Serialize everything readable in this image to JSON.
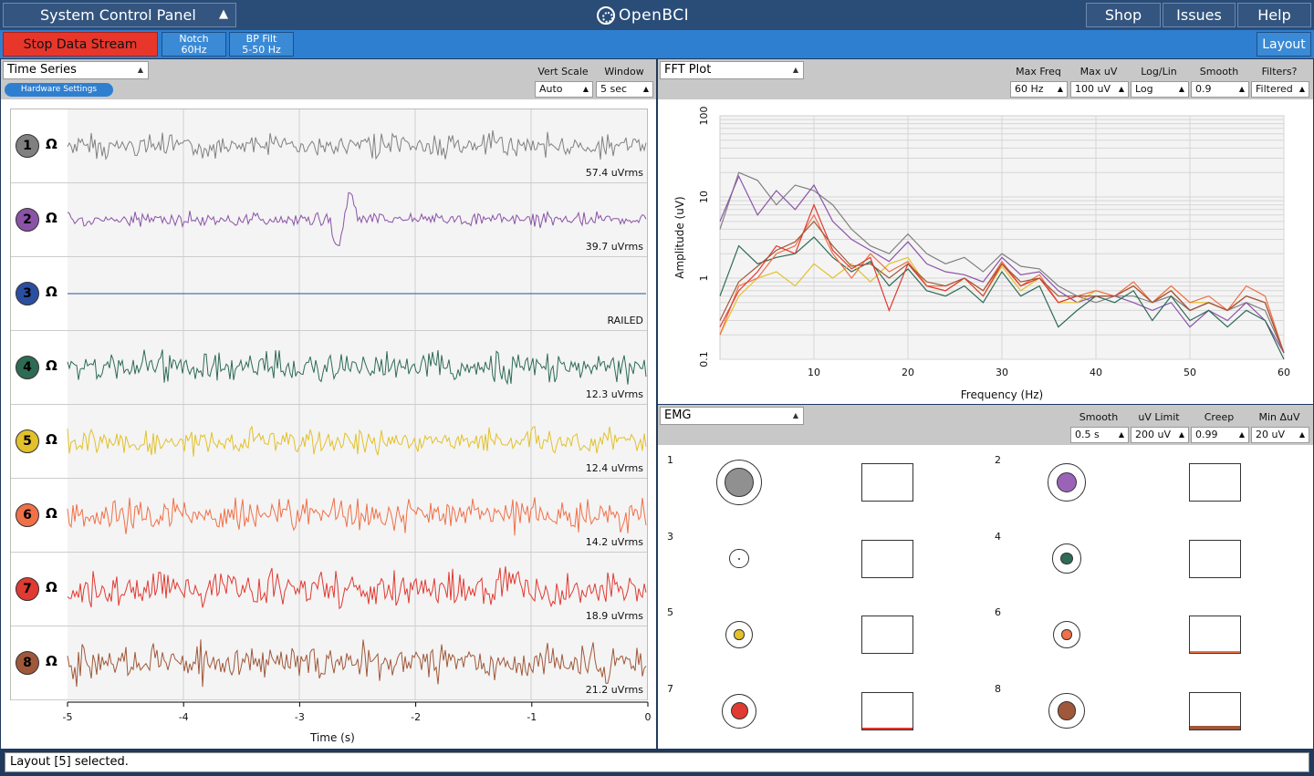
{
  "topbar": {
    "control_panel_label": "System Control Panel",
    "brand": "OpenBCI",
    "shop": "Shop",
    "issues": "Issues",
    "help": "Help"
  },
  "toolbar": {
    "stop_stream": "Stop Data Stream",
    "notch_l1": "Notch",
    "notch_l2": "60Hz",
    "bp_l1": "BP Filt",
    "bp_l2": "5-50 Hz",
    "layout": "Layout"
  },
  "timeseries": {
    "widget_name": "Time Series",
    "hardware_settings": "Hardware Settings",
    "vert_scale_label": "Vert Scale",
    "vert_scale_value": "Auto",
    "window_label": "Window",
    "window_value": "5 sec",
    "xlabel": "Time (s)",
    "xticks": [
      "-5",
      "-4",
      "-3",
      "-2",
      "-1",
      "0"
    ],
    "channels": [
      {
        "num": "1",
        "color": "#808080",
        "rms": "57.4 uVrms"
      },
      {
        "num": "2",
        "color": "#8b53a8",
        "rms": "39.7 uVrms"
      },
      {
        "num": "3",
        "color": "#2b4fa0",
        "rms": "RAILED"
      },
      {
        "num": "4",
        "color": "#2e6b55",
        "rms": "12.3 uVrms"
      },
      {
        "num": "5",
        "color": "#e2c12b",
        "rms": "12.4 uVrms"
      },
      {
        "num": "6",
        "color": "#f07048",
        "rms": "14.2 uVrms"
      },
      {
        "num": "7",
        "color": "#e03a32",
        "rms": "18.9 uVrms"
      },
      {
        "num": "8",
        "color": "#a0583a",
        "rms": "21.2 uVrms"
      }
    ]
  },
  "fft": {
    "widget_name": "FFT Plot",
    "max_freq_label": "Max Freq",
    "max_freq_value": "60 Hz",
    "max_uv_label": "Max uV",
    "max_uv_value": "100 uV",
    "loglin_label": "Log/Lin",
    "loglin_value": "Log",
    "smooth_label": "Smooth",
    "smooth_value": "0.9",
    "filters_label": "Filters?",
    "filters_value": "Filtered",
    "xlabel": "Frequency (Hz)",
    "ylabel": "Amplitude (uV)",
    "xticks": [
      "10",
      "20",
      "30",
      "40",
      "50",
      "60"
    ],
    "yticks": [
      "0.1",
      "1",
      "10",
      "100"
    ]
  },
  "chart_data": {
    "type": "line",
    "title": "",
    "xlabel": "Frequency (Hz)",
    "ylabel": "Amplitude (uV)",
    "xlim": [
      0,
      60
    ],
    "ylim": [
      0.1,
      100
    ],
    "yscale": "log",
    "grid": true,
    "x": [
      0,
      2,
      4,
      6,
      8,
      10,
      12,
      14,
      16,
      18,
      20,
      22,
      24,
      26,
      28,
      30,
      32,
      34,
      36,
      38,
      40,
      42,
      44,
      46,
      48,
      50,
      52,
      54,
      56,
      58,
      60
    ],
    "series": [
      {
        "color": "#808080",
        "values": [
          4,
          20,
          16,
          8,
          14,
          12,
          8,
          4,
          2.5,
          2,
          3.5,
          2,
          1.5,
          1.8,
          1.2,
          2,
          1.4,
          1.3,
          0.8,
          0.6,
          0.5,
          0.6,
          0.6,
          0.5,
          0.6,
          0.4,
          0.5,
          0.4,
          0.5,
          0.4,
          0.12
        ]
      },
      {
        "color": "#8b53a8",
        "values": [
          5,
          18,
          6,
          12,
          7,
          14,
          5,
          3,
          2.2,
          1.6,
          2.8,
          1.5,
          1.2,
          1.1,
          0.9,
          1.8,
          1.1,
          1.2,
          0.7,
          0.5,
          0.6,
          0.6,
          0.5,
          0.4,
          0.5,
          0.25,
          0.4,
          0.3,
          0.5,
          0.3,
          0.12
        ]
      },
      {
        "color": "#2e6b55",
        "values": [
          0.6,
          2.5,
          1.5,
          1.8,
          2,
          3.2,
          1.8,
          1.2,
          1.6,
          0.8,
          1.3,
          0.7,
          0.6,
          0.8,
          0.5,
          1.2,
          0.6,
          0.8,
          0.25,
          0.4,
          0.6,
          0.5,
          0.7,
          0.3,
          0.6,
          0.3,
          0.4,
          0.25,
          0.4,
          0.3,
          0.1
        ]
      },
      {
        "color": "#e2c12b",
        "values": [
          0.2,
          0.6,
          1,
          1.2,
          0.8,
          1.5,
          1,
          1.5,
          0.9,
          1.5,
          1.8,
          0.8,
          0.7,
          1,
          0.6,
          1.4,
          0.7,
          1,
          0.5,
          0.5,
          0.7,
          0.6,
          0.8,
          0.5,
          0.8,
          0.5,
          0.5,
          0.4,
          0.6,
          0.5,
          0.12
        ]
      },
      {
        "color": "#f07048",
        "values": [
          0.2,
          0.8,
          1,
          2,
          2.5,
          6,
          2,
          1,
          2,
          1.2,
          1.6,
          0.8,
          0.8,
          1,
          0.7,
          1.6,
          0.8,
          1.1,
          0.5,
          0.6,
          0.7,
          0.6,
          0.9,
          0.5,
          0.8,
          0.5,
          0.6,
          0.4,
          0.8,
          0.6,
          0.12
        ]
      },
      {
        "color": "#e03a32",
        "values": [
          0.25,
          0.7,
          1.2,
          2.5,
          2,
          8,
          2.2,
          1.3,
          1.8,
          0.4,
          1.5,
          0.8,
          0.7,
          1,
          0.6,
          1.5,
          0.8,
          1,
          0.5,
          0.6,
          0.6,
          0.6,
          0.8,
          0.5,
          0.7,
          0.4,
          0.5,
          0.4,
          0.6,
          0.5,
          0.12
        ]
      },
      {
        "color": "#a0583a",
        "values": [
          0.3,
          0.9,
          1.4,
          2.2,
          2.8,
          5,
          2.5,
          1.4,
          1.5,
          1,
          1.5,
          0.9,
          0.8,
          1,
          0.7,
          1.5,
          0.9,
          1,
          0.6,
          0.6,
          0.6,
          0.6,
          0.8,
          0.5,
          0.7,
          0.4,
          0.5,
          0.4,
          0.6,
          0.5,
          0.12
        ]
      }
    ]
  },
  "emg": {
    "widget_name": "EMG",
    "smooth_label": "Smooth",
    "smooth_value": "0.5 s",
    "uv_limit_label": "uV Limit",
    "uv_limit_value": "200 uV",
    "creep_label": "Creep",
    "creep_value": "0.99",
    "min_duv_label": "Min ΔuV",
    "min_duv_value": "20 uV",
    "channels": [
      {
        "num": "1",
        "color": "#909090",
        "level": 0.85
      },
      {
        "num": "2",
        "color": "#9b63b8",
        "level": 0.6
      },
      {
        "num": "3",
        "color": "#222222",
        "level": 0.05
      },
      {
        "num": "4",
        "color": "#2e6b55",
        "level": 0.35
      },
      {
        "num": "5",
        "color": "#e2c12b",
        "level": 0.3
      },
      {
        "num": "6",
        "color": "#f07048",
        "level": 0.3
      },
      {
        "num": "7",
        "color": "#e03a32",
        "level": 0.5
      },
      {
        "num": "8",
        "color": "#a0583a",
        "level": 0.55
      }
    ],
    "bar_fill": [
      0,
      0,
      0,
      0,
      0,
      0.05,
      0.03,
      0.1
    ]
  },
  "status": {
    "message": "Layout [5] selected."
  }
}
